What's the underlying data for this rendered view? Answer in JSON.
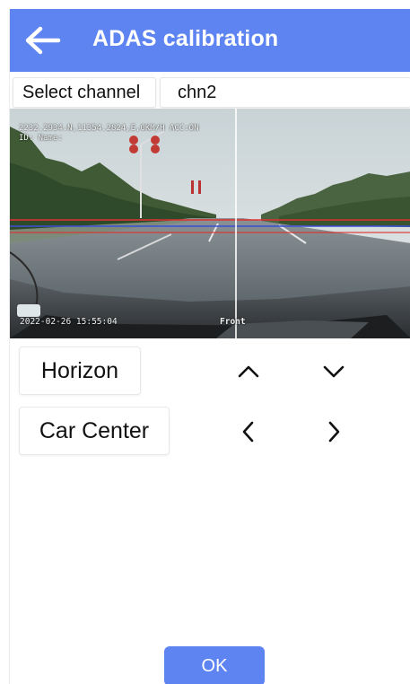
{
  "header": {
    "title": "ADAS calibration",
    "back_icon": "arrow-left-icon",
    "background": "#5e84f2"
  },
  "channel": {
    "label": "Select channel",
    "value": "chn2"
  },
  "camera": {
    "overlay_top_line1": "2232.2934.N,11354.2824,E,0KM/H ACC:ON",
    "overlay_top_line2": "ID: Name:",
    "timestamp": "2022-02-26 15:55:04",
    "view_label": "Front",
    "line_colors": {
      "horizon": "#e0302f",
      "center": "#3a4fd8",
      "vertical": "#ffffff"
    }
  },
  "controls": {
    "horizon_label": "Horizon",
    "car_center_label": "Car Center",
    "icons": {
      "up": "chevron-up-icon",
      "down": "chevron-down-icon",
      "left": "chevron-left-icon",
      "right": "chevron-right-icon"
    }
  },
  "footer": {
    "ok_label": "OK"
  }
}
